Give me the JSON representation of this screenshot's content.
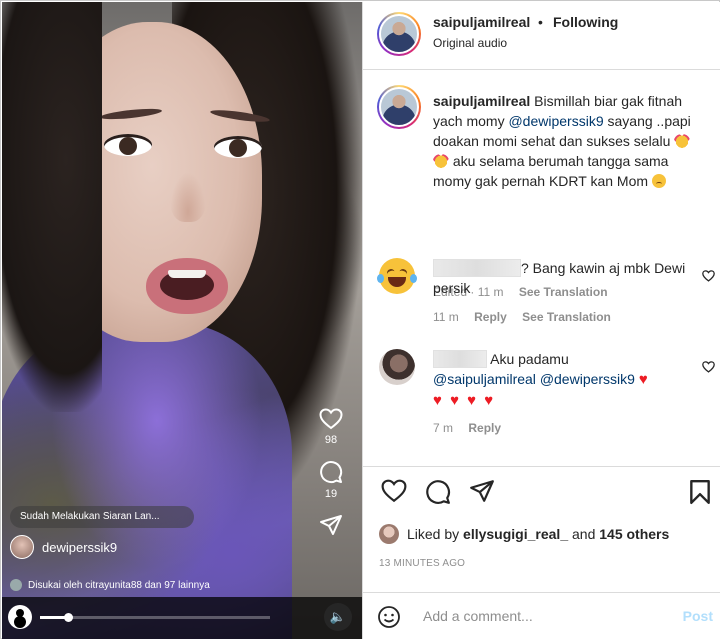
{
  "header": {
    "username": "saipuljamilreal",
    "separator": "•",
    "follow_status": "Following",
    "audio": "Original audio"
  },
  "caption": {
    "username": "saipuljamilreal",
    "text_1": "Bismillah biar gak fitnah yach momy ",
    "mention": "@dewiperssik9",
    "text_2": " sayang ..papi doakan momi sehat dan sukses selalu ",
    "text_3": " aku selama berumah tangga sama momy gak pernah KDRT kan Mom ",
    "edited": "Edited · 11 m",
    "see_translation": "See Translation"
  },
  "comments": [
    {
      "text_suffix": "? Bang kawin aj mbk Dewi persik",
      "time": "11 m",
      "reply": "Reply",
      "see_translation": "See Translation"
    },
    {
      "text_1": "Aku padamu",
      "mention_1": "@saipuljamilreal",
      "mention_2": "@dewiperssik9",
      "hearts_line_1": "♥",
      "hearts_line_2": "♥ ♥ ♥ ♥",
      "time": "7 m",
      "reply": "Reply"
    }
  ],
  "likes": {
    "prefix": "Liked by ",
    "user": "ellysugigi_real_",
    "middle": " and ",
    "others": "145 others"
  },
  "time_ago": "13 MINUTES AGO",
  "add_comment": {
    "placeholder": "Add a comment...",
    "post": "Post"
  },
  "reel": {
    "likes_count": "98",
    "comments_count": "19",
    "live_chip": "Sudah Melakukan Siaran Lan...",
    "username": "dewiperssik9",
    "liked_by": "Disukai oleh citrayunita88 dan 97 lainnya",
    "progress": 0.12
  },
  "colors": {
    "mention": "#00376b",
    "post_disabled": "#b2dffc",
    "heart_red": "#ed1c24"
  }
}
